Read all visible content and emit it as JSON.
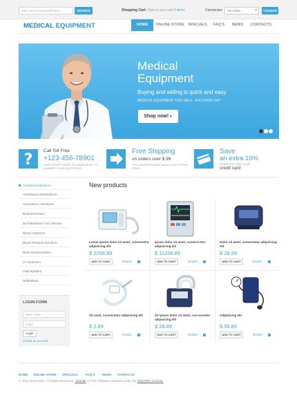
{
  "topbar": {
    "search_placeholder": "enter search keywords here",
    "search_button": "SEARCH",
    "cart_label": "Shopping Cart:",
    "cart_status_prefix": "Now in your cart",
    "cart_status_items": "0 items",
    "currencies_label": "Currencies:",
    "currency_value": "US Dollar",
    "change_button": "CHANGE"
  },
  "header": {
    "logo_part1": "MEDICAL",
    "logo_part2": "EQUIPMENT",
    "nav": [
      "HOME",
      "ONLINE STORE",
      "SPECIALS",
      "FAQ'S",
      "NEWS",
      "CONTACTS"
    ],
    "active_nav": "HOME"
  },
  "banner": {
    "title_line1": "Medical",
    "title_line2": "Equipment",
    "subtitle": "Buying and selling is quick and easy",
    "tagline": "MEDICAL EQUIPMENT FOR SALE - AUCTIONS 24/7",
    "cta": "Shop now!",
    "slides": 3,
    "active_slide": 1
  },
  "info": {
    "call_line": "Call Toll Free",
    "phone": "+123-456-78901",
    "call_note": "OUR EXPERT STAFF IS STANDING BY TO ANSWER YOUR QUESTIONS",
    "shipping_title": "Free Shipping",
    "shipping_line": "on orders over $ 99",
    "shipping_note": "THIS OFFER IS VALID ON ALL OUR STORE ITEMS",
    "save_title": "Save",
    "save_line": "an extra 10%",
    "save_note": "WHEN YOU USE YOUR",
    "save_card": "credit card"
  },
  "sidebar": {
    "categories": [
      "Anesthesia Monitors",
      "Anesthesia Workstations",
      "Autoclaves / Sterilizers",
      "Beds/Stretchers",
      "BoZ Machines / ICG Monitor",
      "Blood Analyzers",
      "Blood Pressure Monitors",
      "Bone Densitometers",
      "CT Scanners",
      "Capnography",
      "Defibrillator"
    ],
    "login_title": "LOGIN FORM",
    "username_placeholder": "User name",
    "password_placeholder": "Login",
    "login_button": "Login",
    "create_account": "Create an account"
  },
  "products": {
    "heading": "New products",
    "add_to_cart": "ADD TO CART",
    "details": "Details",
    "items": [
      {
        "name": "Lorem ipsum dolor sit amet, consectetur adipisicing elit",
        "price": "$ 2258.89"
      },
      {
        "name": "Ipsum dolor sit amet, consect-etur adipisicing elit",
        "price": "$ 11258.89"
      },
      {
        "name": "Dolor sit amet, consectetur adipisicing elit",
        "price": "$ 28.89"
      },
      {
        "name": "Sit amet, consectetur adipisicing elit",
        "price": "$ 2.89"
      },
      {
        "name": "Sit ipsum dolor sit amet, con-sectetur adipisicing elit",
        "price": "$ 28.89"
      },
      {
        "name": "Adipisicing elit",
        "price": "$ 58.89"
      }
    ]
  },
  "footer": {
    "nav": [
      "HOME",
      "ONLINE STORE",
      "SPECIALS",
      "FAQ'S",
      "NEWS",
      "CONTACTS"
    ],
    "copyright_prefix": "© 2011 Virtue Mart. All Rights Reserved.",
    "joomla": "Joomla!",
    "copyright_mid": "is Free Software released under the",
    "license": "GNU/GPL License."
  },
  "colors": {
    "accent": "#3ea6dc",
    "logo": "#2c9ad6"
  }
}
